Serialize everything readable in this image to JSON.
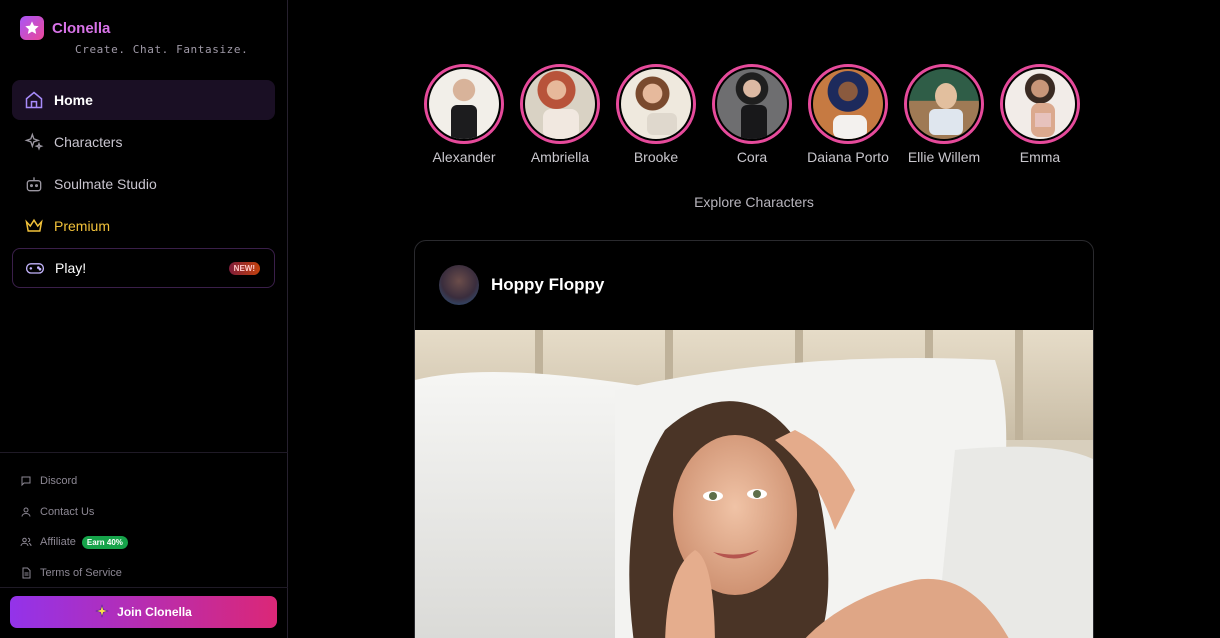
{
  "brand": {
    "name": "Clonella",
    "tagline": "Create. Chat. Fantasize."
  },
  "nav": {
    "items": [
      {
        "label": "Home",
        "icon": "home-icon"
      },
      {
        "label": "Characters",
        "icon": "sparkles-icon"
      },
      {
        "label": "Soulmate Studio",
        "icon": "robot-icon"
      },
      {
        "label": "Premium",
        "icon": "crown-icon"
      },
      {
        "label": "Play!",
        "icon": "gamepad-icon",
        "badge": "NEW!"
      }
    ]
  },
  "footer": {
    "links": [
      {
        "label": "Discord",
        "icon": "message-icon"
      },
      {
        "label": "Contact Us",
        "icon": "user-icon"
      },
      {
        "label": "Affiliate",
        "icon": "users-icon",
        "badge": "Earn 40%"
      },
      {
        "label": "Terms of Service",
        "icon": "document-icon"
      }
    ],
    "join_label": "Join Clonella"
  },
  "stories": [
    {
      "name": "Alexander"
    },
    {
      "name": "Ambriella"
    },
    {
      "name": "Brooke"
    },
    {
      "name": "Cora"
    },
    {
      "name": "Daiana Porto"
    },
    {
      "name": "Ellie Willem"
    },
    {
      "name": "Emma"
    }
  ],
  "explore_label": "Explore Characters",
  "post": {
    "author": "Hoppy Floppy"
  },
  "colors": {
    "accent": "#e64a9b",
    "brand": "#d873e8",
    "premium": "#f2c23a"
  }
}
